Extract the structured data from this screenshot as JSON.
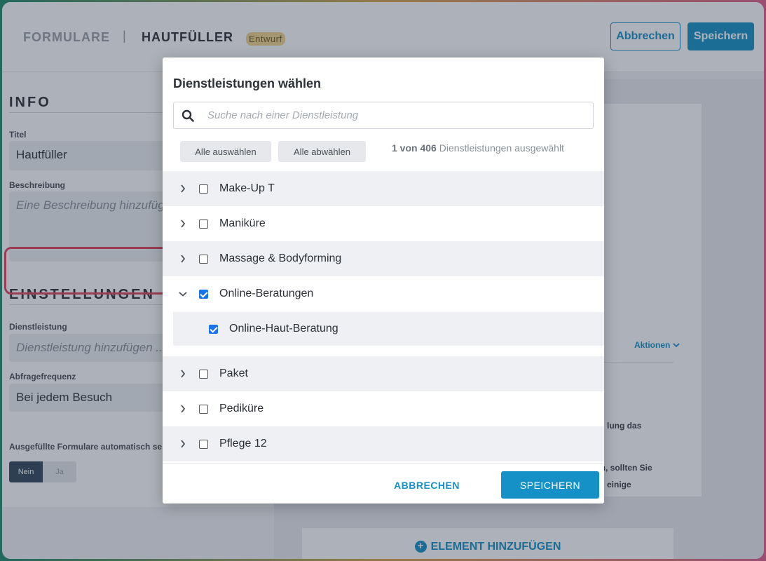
{
  "header": {
    "breadcrumb_root": "FORMULARE",
    "separator": "|",
    "form_name": "HAUTFÜLLER",
    "status_badge": "Entwurf",
    "cancel_label": "Abbrechen",
    "save_label": "Speichern"
  },
  "info": {
    "section_title": "INFO",
    "title_label": "Titel",
    "title_value": "Hautfüller",
    "description_label": "Beschreibung",
    "description_placeholder": "Eine Beschreibung hinzufügen"
  },
  "settings": {
    "section_title": "EINSTELLUNGEN",
    "service_label": "Dienstleistung",
    "service_placeholder": "Dienstleistung hinzufügen ...",
    "frequency_label": "Abfragefrequenz",
    "frequency_value": "Bei jedem Besuch",
    "autosend_label": "Ausgefüllte Formulare automatisch se",
    "toggle_no": "Nein",
    "toggle_yes": "Ja"
  },
  "right_panel": {
    "actions_label": "Aktionen",
    "text_1": "lung das",
    "text_2": "en, sollten Sie",
    "text_3": "einige",
    "add_element_label": "ELEMENT HINZUFÜGEN"
  },
  "modal": {
    "title": "Dienstleistungen wählen",
    "search_placeholder": "Suche nach einer Dienstleistung",
    "select_all": "Alle auswählen",
    "deselect_all": "Alle abwählen",
    "count_selected": "1 von 406",
    "count_suffix": " Dienstleistungen ausgewählt",
    "items": [
      {
        "label": "Make-Up T",
        "checked": false,
        "expanded": false
      },
      {
        "label": "Maniküre",
        "checked": false,
        "expanded": false
      },
      {
        "label": "Massage & Bodyforming",
        "checked": false,
        "expanded": false
      },
      {
        "label": "Online-Beratungen",
        "checked": true,
        "expanded": true
      },
      {
        "label": "Online-Haut-Beratung",
        "checked": true,
        "child": true
      },
      {
        "label": "Paket",
        "checked": false,
        "expanded": false
      },
      {
        "label": "Pediküre",
        "checked": false,
        "expanded": false
      },
      {
        "label": "Pflege 12",
        "checked": false,
        "expanded": false
      }
    ],
    "cancel_label": "ABBRECHEN",
    "save_label": "SPEICHERN"
  }
}
